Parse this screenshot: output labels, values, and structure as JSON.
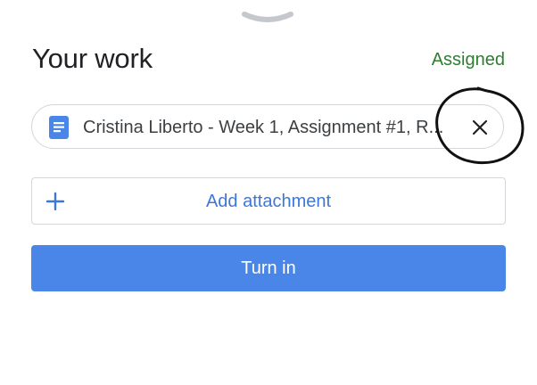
{
  "handle": {
    "icon": "chevron-down-icon"
  },
  "header": {
    "title": "Your work",
    "status": "Assigned"
  },
  "attachment": {
    "icon": "google-docs-icon",
    "name": "Cristina Liberto - Week 1, Assignment #1, R...",
    "remove_icon": "close-icon"
  },
  "add_attachment": {
    "icon": "plus-icon",
    "label": "Add attachment"
  },
  "turn_in": {
    "label": "Turn in"
  },
  "colors": {
    "status_green": "#2e7d32",
    "accent_blue": "#4a86e8",
    "link_blue": "#3b78d8",
    "border_gray": "#d3d6da"
  }
}
